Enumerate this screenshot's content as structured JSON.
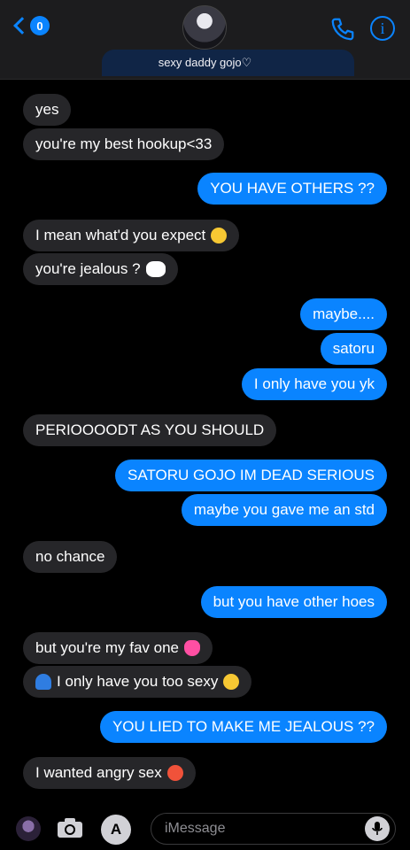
{
  "header": {
    "back_count": "0",
    "contact_name": "sexy daddy gojo♡",
    "accent_color": "#0a84ff"
  },
  "messages": [
    {
      "side": "in",
      "text": "yes"
    },
    {
      "side": "in",
      "text": "you're my best hookup<33"
    },
    {
      "side": "out",
      "text": "YOU HAVE OTHERS ??"
    },
    {
      "side": "in",
      "text": "I mean what'd you expect",
      "emoji": "heart-eyes-emoji"
    },
    {
      "side": "in",
      "text": "you're jealous ?",
      "emoji": "eyes-emoji"
    },
    {
      "side": "out",
      "text": "maybe...."
    },
    {
      "side": "out",
      "text": "satoru"
    },
    {
      "side": "out",
      "text": "I only have you yk"
    },
    {
      "side": "in",
      "text": "PERIOOOODT AS YOU SHOULD"
    },
    {
      "side": "out",
      "text": "SATORU GOJO IM DEAD SERIOUS"
    },
    {
      "side": "out",
      "text": "maybe you gave me an std"
    },
    {
      "side": "in",
      "text": "no chance"
    },
    {
      "side": "out",
      "text": "but you have other hoes"
    },
    {
      "side": "in",
      "text": "but you're my fav one",
      "emoji": "pink-heart-emoji"
    },
    {
      "side": "in",
      "text": "I only have you too sexy",
      "emoji": "smirk-emoji",
      "prefix_emoji": "blue-cap-emoji"
    },
    {
      "side": "out",
      "text": "YOU LIED TO MAKE ME JEALOUS ??"
    },
    {
      "side": "in",
      "text": "I wanted angry sex",
      "emoji": "hot-face-emoji"
    }
  ],
  "composer": {
    "placeholder": "iMessage"
  }
}
